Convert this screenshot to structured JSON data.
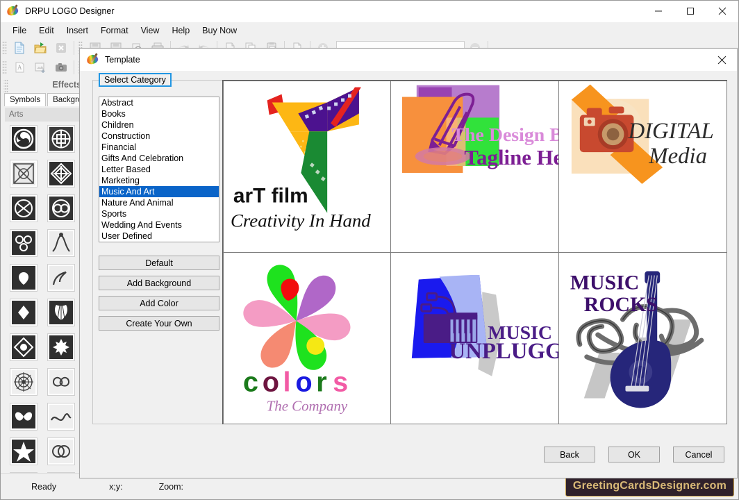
{
  "window": {
    "title": "DRPU LOGO Designer",
    "icon": "palette-brush-icon",
    "minimize": "minimize-icon",
    "maximize": "maximize-icon",
    "close": "close-icon"
  },
  "menu": {
    "items": [
      {
        "label": "File"
      },
      {
        "label": "Edit"
      },
      {
        "label": "Insert"
      },
      {
        "label": "Format"
      },
      {
        "label": "View"
      },
      {
        "label": "Help"
      },
      {
        "label": "Buy Now"
      }
    ]
  },
  "toolbar": {
    "row1_icons": [
      "new-document-icon",
      "open-folder-icon",
      "close-document-icon",
      "save-icon",
      "save-as-icon",
      "print-preview-icon",
      "print-icon",
      "undo-icon",
      "redo-icon",
      "cut-icon",
      "copy-icon",
      "paste-icon",
      "duplicate-icon",
      "zoom-in-icon"
    ],
    "row2_icons": [
      "insert-text-icon",
      "insert-image-icon",
      "capture-camera-icon"
    ],
    "combo_value": "",
    "zoom_out_icon": "zoom-out-icon"
  },
  "left_panel": {
    "effects_header": "Effects",
    "tabs": [
      {
        "label": "Symbols",
        "active": true
      },
      {
        "label": "Background",
        "active": false
      }
    ],
    "section_header": "Arts",
    "symbol_count": 22
  },
  "dialog": {
    "title": "Template",
    "icon": "palette-brush-icon",
    "close": "close-icon",
    "category_legend": "Select Category",
    "categories": [
      {
        "label": "Abstract",
        "selected": false
      },
      {
        "label": "Books",
        "selected": false
      },
      {
        "label": "Children",
        "selected": false
      },
      {
        "label": "Construction",
        "selected": false
      },
      {
        "label": "Financial",
        "selected": false
      },
      {
        "label": "Gifts And Celebration",
        "selected": false
      },
      {
        "label": "Letter Based",
        "selected": false
      },
      {
        "label": "Marketing",
        "selected": false
      },
      {
        "label": "Music And Art",
        "selected": true
      },
      {
        "label": "Nature And Animal",
        "selected": false
      },
      {
        "label": "Sports",
        "selected": false
      },
      {
        "label": "Wedding And Events",
        "selected": false
      },
      {
        "label": "User Defined",
        "selected": false
      }
    ],
    "side_buttons": [
      {
        "label": "Default"
      },
      {
        "label": "Add Background"
      },
      {
        "label": "Add Color"
      },
      {
        "label": "Create Your Own"
      }
    ],
    "templates": [
      {
        "id": "art-film",
        "name": "arT film",
        "tagline": "Creativity In Hand"
      },
      {
        "id": "design-bag",
        "name": "The Design Bag",
        "tagline": "Tagline Here"
      },
      {
        "id": "digital-media",
        "name": "DIGITAL",
        "tagline": "Media"
      },
      {
        "id": "colors",
        "name": "colors",
        "tagline": "The Company"
      },
      {
        "id": "music-unplugged",
        "name": "MUSIC",
        "tagline": "UNPLUGGED"
      },
      {
        "id": "music-rocks",
        "name": "MUSIC",
        "tagline": "ROCKS"
      }
    ],
    "footer_buttons": [
      {
        "label": "Back"
      },
      {
        "label": "OK"
      },
      {
        "label": "Cancel"
      }
    ]
  },
  "status_bar": {
    "ready": "Ready",
    "xy": "x;y:",
    "zoom": "Zoom:",
    "watermark": "GreetingCardsDesigner.com"
  },
  "colors": {
    "selection_blue": "#0a64c8",
    "legend_border_blue": "#2196e3",
    "watermark_bg": "#30212b",
    "watermark_text": "#d9b977",
    "window_bg": "#f0f0f0"
  }
}
